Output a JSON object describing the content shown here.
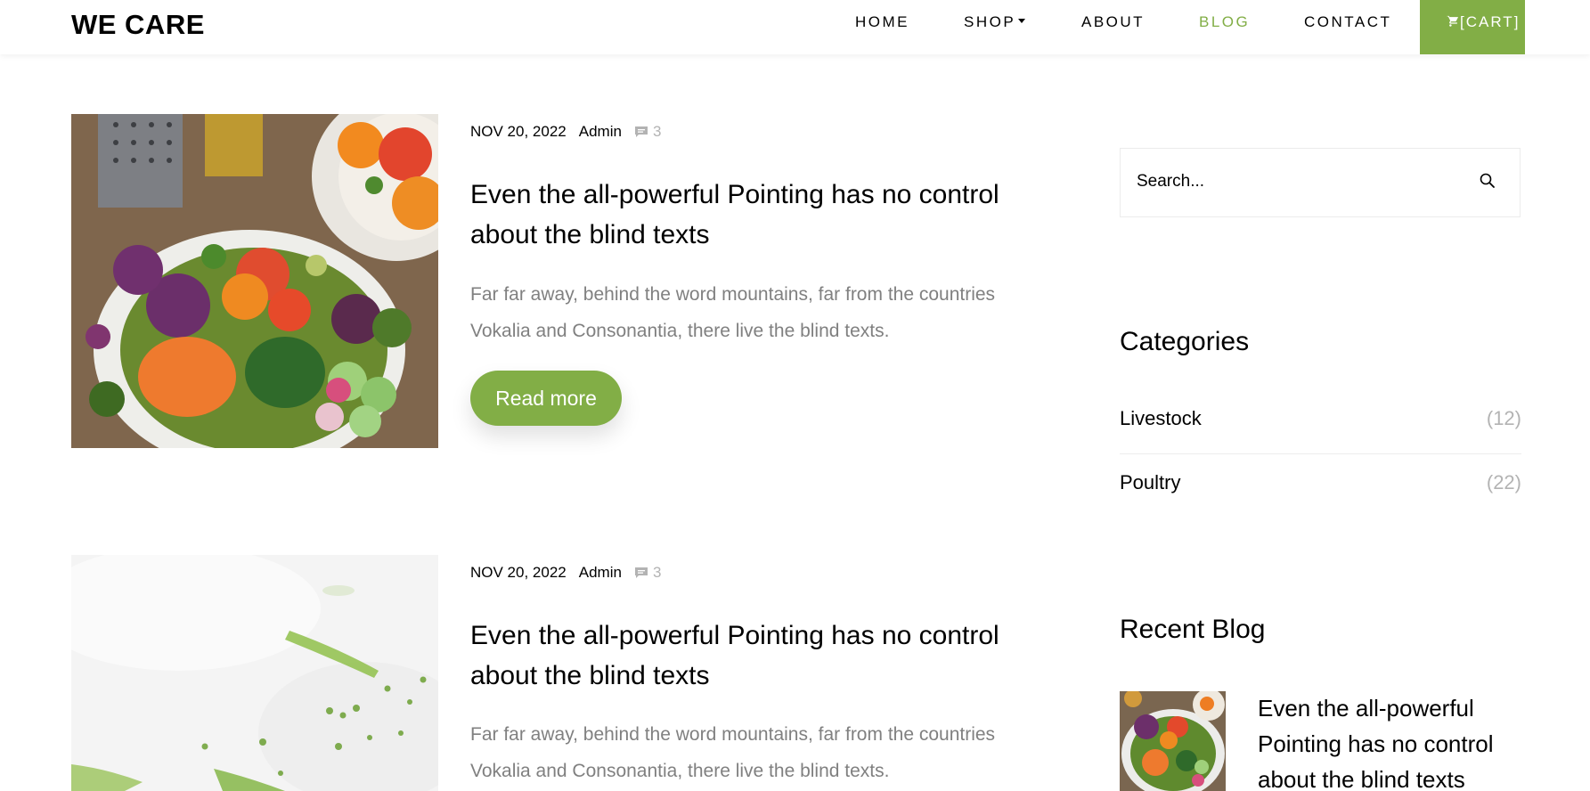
{
  "nav": {
    "brand": "WE CARE",
    "items": [
      {
        "label": "HOME"
      },
      {
        "label": "SHOP"
      },
      {
        "label": "ABOUT"
      },
      {
        "label": "BLOG"
      },
      {
        "label": "CONTACT"
      }
    ],
    "cart_label": "[CART]",
    "accent_color": "#82ae46"
  },
  "posts": [
    {
      "date": "NOV 20, 2022",
      "author": "Admin",
      "comments": "3",
      "title": "Even the all-powerful Pointing has no control about the blind texts",
      "excerpt": "Far far away, behind the word mountains, far from the countries Vokalia and Consonantia, there live the blind texts.",
      "read_more": "Read more",
      "image": "salad-bowl-photo"
    },
    {
      "date": "NOV 20, 2022",
      "author": "Admin",
      "comments": "3",
      "title": "Even the all-powerful Pointing has no control about the blind texts",
      "excerpt": "Far far away, behind the word mountains, far from the countries Vokalia and Consonantia, there live the blind texts.",
      "image": "white-background-greens-photo"
    }
  ],
  "sidebar": {
    "search": {
      "placeholder": "Search..."
    },
    "categories_heading": "Categories",
    "categories": [
      {
        "label": "Livestock",
        "count": "(12)"
      },
      {
        "label": "Poultry",
        "count": "(22)"
      }
    ],
    "recent_heading": "Recent Blog",
    "recent": [
      {
        "title": "Even the all-powerful Pointing has no control about the blind texts",
        "image": "salad-bowl-photo"
      }
    ]
  }
}
